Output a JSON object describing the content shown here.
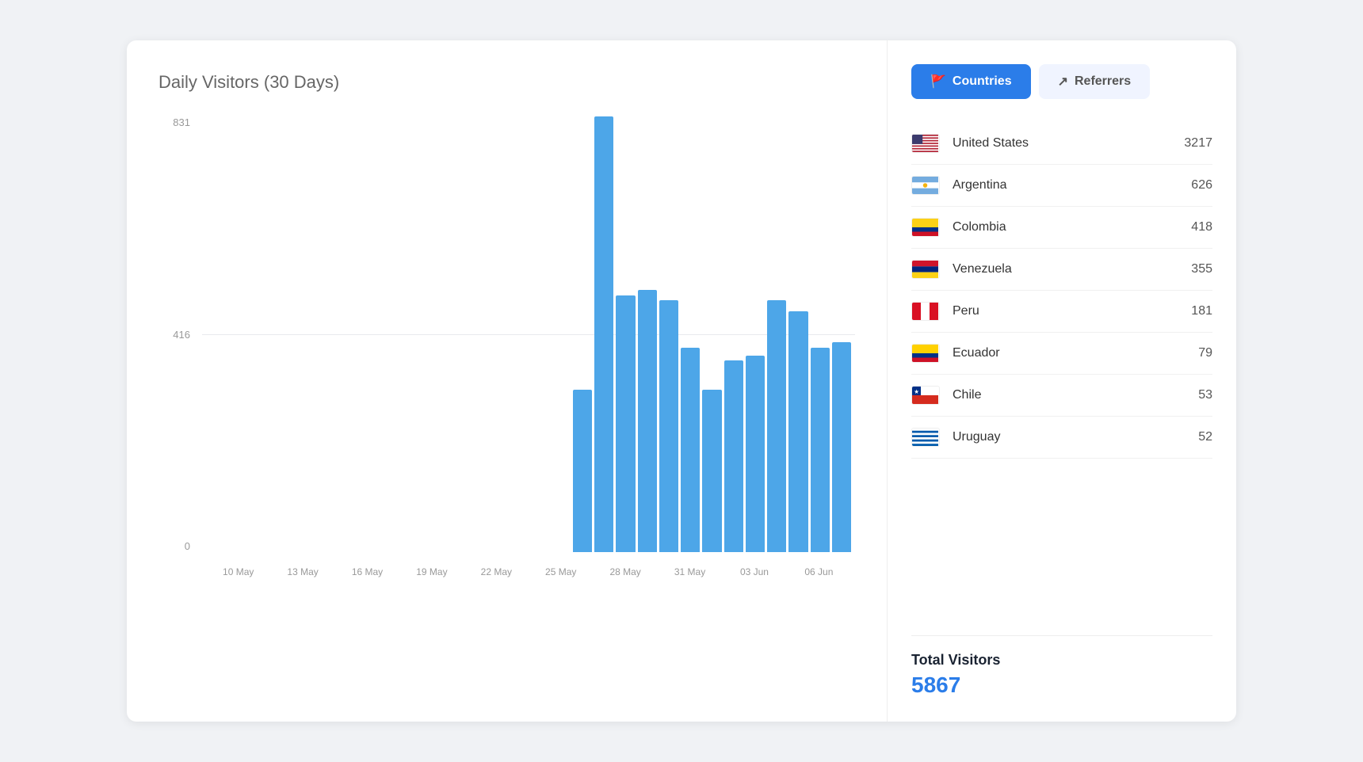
{
  "chart": {
    "title": "Daily Visitors",
    "subtitle": "(30 Days)",
    "y_labels": [
      "831",
      "416",
      "0"
    ],
    "x_labels": [
      "10 May",
      "13 May",
      "16 May",
      "19 May",
      "22 May",
      "25 May",
      "28 May",
      "31 May",
      "03 Jun",
      "06 Jun"
    ],
    "max_value": 831,
    "bars": [
      {
        "date": "10 May",
        "value": 0
      },
      {
        "date": "11 May",
        "value": 0
      },
      {
        "date": "12 May",
        "value": 0
      },
      {
        "date": "13 May",
        "value": 0
      },
      {
        "date": "14 May",
        "value": 0
      },
      {
        "date": "15 May",
        "value": 0
      },
      {
        "date": "16 May",
        "value": 0
      },
      {
        "date": "17 May",
        "value": 0
      },
      {
        "date": "18 May",
        "value": 0
      },
      {
        "date": "19 May",
        "value": 0
      },
      {
        "date": "20 May",
        "value": 0
      },
      {
        "date": "21 May",
        "value": 0
      },
      {
        "date": "22 May",
        "value": 0
      },
      {
        "date": "23 May",
        "value": 0
      },
      {
        "date": "24 May",
        "value": 0
      },
      {
        "date": "25 May",
        "value": 0
      },
      {
        "date": "26 May",
        "value": 0
      },
      {
        "date": "27 May",
        "value": 310
      },
      {
        "date": "28 May",
        "value": 831
      },
      {
        "date": "29 May",
        "value": 490
      },
      {
        "date": "30 May",
        "value": 500
      },
      {
        "date": "31 May",
        "value": 480
      },
      {
        "date": "01 Jun",
        "value": 390
      },
      {
        "date": "02 Jun",
        "value": 310
      },
      {
        "date": "03 Jun",
        "value": 365
      },
      {
        "date": "04 Jun",
        "value": 375
      },
      {
        "date": "05 Jun",
        "value": 480
      },
      {
        "date": "06 Jun",
        "value": 460
      },
      {
        "date": "07 Jun",
        "value": 390
      },
      {
        "date": "08 Jun",
        "value": 400
      }
    ]
  },
  "tabs": {
    "countries_label": "Countries",
    "referrers_label": "Referrers"
  },
  "countries": [
    {
      "name": "United States",
      "count": "3217",
      "flag_class": "flag-us"
    },
    {
      "name": "Argentina",
      "count": "626",
      "flag_class": "flag-ar"
    },
    {
      "name": "Colombia",
      "count": "418",
      "flag_class": "flag-co"
    },
    {
      "name": "Venezuela",
      "count": "355",
      "flag_class": "flag-ve"
    },
    {
      "name": "Peru",
      "count": "181",
      "flag_class": "flag-pe"
    },
    {
      "name": "Ecuador",
      "count": "79",
      "flag_class": "flag-ec"
    },
    {
      "name": "Chile",
      "count": "53",
      "flag_class": "flag-cl"
    },
    {
      "name": "Uruguay",
      "count": "52",
      "flag_class": "flag-uy"
    }
  ],
  "totals": {
    "label": "Total Visitors",
    "value": "5867"
  }
}
